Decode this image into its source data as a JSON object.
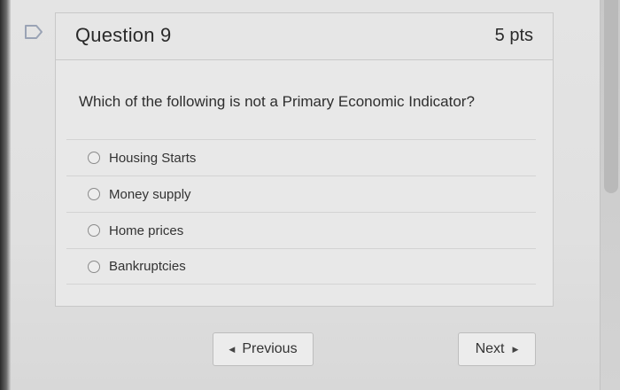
{
  "question": {
    "title": "Question 9",
    "points": "5 pts",
    "text": "Which of the following is not a Primary Economic Indicator?",
    "answers": [
      {
        "label": "Housing Starts"
      },
      {
        "label": "Money supply"
      },
      {
        "label": "Home prices"
      },
      {
        "label": "Bankruptcies"
      }
    ]
  },
  "navigation": {
    "previous_label": "Previous",
    "next_label": "Next",
    "previous_icon": "triangle-left-icon",
    "next_icon": "triangle-right-icon"
  },
  "icons": {
    "flag": "flag-icon"
  },
  "colors": {
    "background": "#e0e0e0",
    "card": "#e8e8e8",
    "text": "#2a2a2a",
    "flag_stroke": "#9aa3b5"
  }
}
